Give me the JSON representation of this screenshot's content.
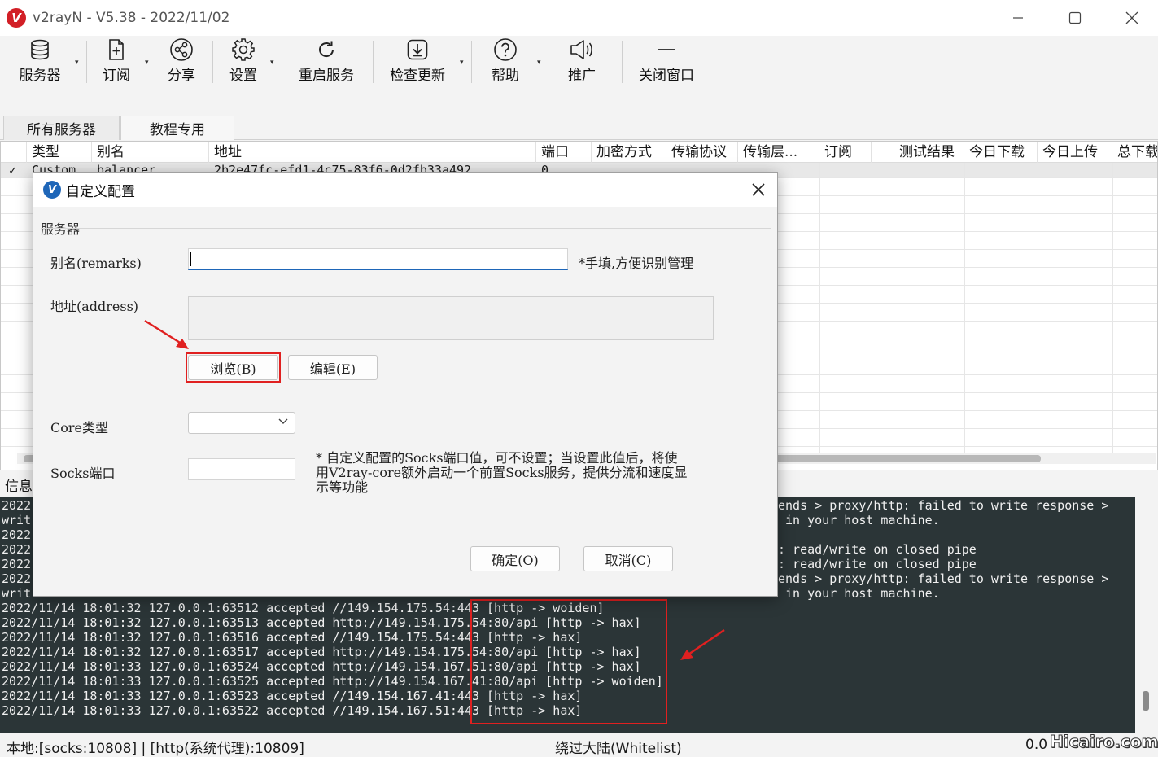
{
  "window": {
    "title": "v2rayN - V5.38 - 2022/11/02",
    "logo_glyph": "V"
  },
  "toolbar": {
    "items": [
      {
        "label": "服务器",
        "icon": "database-icon"
      },
      {
        "label": "订阅",
        "icon": "subscribe-icon"
      },
      {
        "label": "分享",
        "icon": "share-icon"
      },
      {
        "label": "设置",
        "icon": "gear-icon"
      },
      {
        "label": "重启服务",
        "icon": "restart-icon"
      },
      {
        "label": "检查更新",
        "icon": "download-icon"
      },
      {
        "label": "帮助",
        "icon": "help-icon"
      },
      {
        "label": "推广",
        "icon": "speaker-icon"
      },
      {
        "label": "关闭窗口",
        "icon": "minus-icon"
      }
    ]
  },
  "tabs": [
    "所有服务器",
    "教程专用"
  ],
  "grid": {
    "columns": [
      "类型",
      "别名",
      "地址",
      "端口",
      "加密方式",
      "传输协议",
      "传输层...",
      "订阅",
      "测试结果",
      "今日下载",
      "今日上传",
      "总下载"
    ],
    "row": {
      "check": "✓",
      "type": "Custom",
      "alias": "balancer",
      "address": "2b2e47fc-efd1-4c75-83f6-0d2fb33a492",
      "port": "0"
    }
  },
  "info_label": "信息",
  "log": {
    "partial_lines": [
      {
        "prefix": "2022",
        "suffix": "ends > proxy/http: failed to write response >"
      },
      {
        "prefix": "writ",
        "suffix": " in your host machine."
      },
      {
        "prefix": "2022",
        "suffix": ""
      },
      {
        "prefix": "2022",
        "suffix": ": read/write on closed pipe"
      },
      {
        "prefix": "2022",
        "suffix": ": read/write on closed pipe"
      },
      {
        "prefix": "2022",
        "suffix": "ends > proxy/http: failed to write response >"
      },
      {
        "prefix": "writ",
        "suffix": " in your host machine."
      }
    ],
    "lines": [
      "2022/11/14 18:01:32 127.0.0.1:63512 accepted //149.154.175.54:443 [http -> woiden]",
      "2022/11/14 18:01:32 127.0.0.1:63513 accepted http://149.154.175.54:80/api [http -> hax]",
      "2022/11/14 18:01:32 127.0.0.1:63516 accepted //149.154.175.54:443 [http -> hax]",
      "2022/11/14 18:01:32 127.0.0.1:63517 accepted http://149.154.175.54:80/api [http -> hax]",
      "2022/11/14 18:01:33 127.0.0.1:63524 accepted http://149.154.167.51:80/api [http -> hax]",
      "2022/11/14 18:01:33 127.0.0.1:63525 accepted http://149.154.167.41:80/api [http -> woiden]",
      "2022/11/14 18:01:33 127.0.0.1:63523 accepted //149.154.167.41:443 [http -> hax]",
      "2022/11/14 18:01:33 127.0.0.1:63522 accepted //149.154.167.51:443 [http -> hax]"
    ]
  },
  "statusbar": {
    "left": "本地:[socks:10808] | [http(系统代理):10809]",
    "middle": "绕过大陆(Whitelist)",
    "right": "0.0"
  },
  "watermark": "Hicairo.com",
  "dialog": {
    "title": "自定义配置",
    "group": "服务器",
    "remarks_label": "别名(remarks)",
    "remarks_value": "",
    "remarks_hint": "*手填,方便识别管理",
    "address_label": "地址(address)",
    "address_value": "",
    "browse_button": "浏览(B)",
    "edit_button": "编辑(E)",
    "core_label": "Core类型",
    "core_value": "",
    "socks_label": "Socks端口",
    "socks_value": "",
    "socks_hint_1": "* 自定义配置的Socks端口值，可不设置；当设置此值后，将使",
    "socks_hint_2": "用V2ray-core额外启动一个前置Socks服务，提供分流和速度显",
    "socks_hint_3": "示等功能",
    "ok_button": "确定(O)",
    "cancel_button": "取消(C)"
  },
  "colors": {
    "accent": "#1e66b8",
    "highlight": "#e02020",
    "log_bg": "#2b3537",
    "logo": "#d21f26"
  }
}
